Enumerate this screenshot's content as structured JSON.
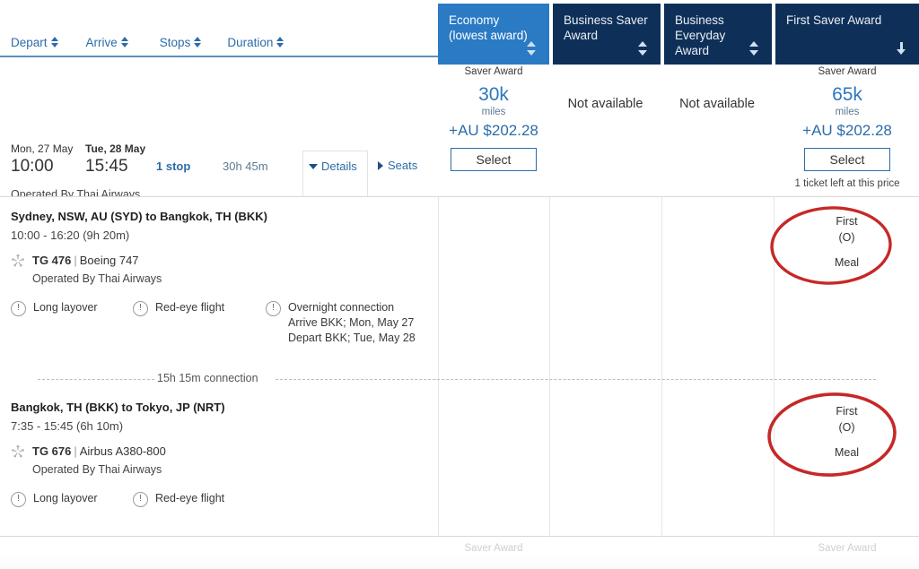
{
  "sort_bar": {
    "items": [
      {
        "label": "Depart",
        "icon": "sort-updown-icon"
      },
      {
        "label": "Arrive",
        "icon": "sort-updown-icon"
      },
      {
        "label": "Stops",
        "icon": "sort-updown-icon"
      },
      {
        "label": "Duration",
        "icon": "sort-updown-icon"
      }
    ]
  },
  "fare_tabs": [
    {
      "label": "Economy\n(lowest award)",
      "line1": "Economy",
      "line2": "(lowest award)",
      "selected": true,
      "sort_icon": "sort-updown-icon"
    },
    {
      "label": "Business Saver Award",
      "line1": "Business Saver",
      "line2": "Award",
      "selected": false,
      "sort_icon": "sort-updown-icon"
    },
    {
      "label": "Business Everyday Award",
      "line1": "Business",
      "line2": "Everyday Award",
      "selected": false,
      "sort_icon": "sort-updown-icon"
    },
    {
      "label": "First Saver Award",
      "line1": "First Saver Award",
      "line2": "",
      "selected": false,
      "sort_icon": "sort-down-icon"
    }
  ],
  "itinerary": {
    "depart_date": "Mon, 27 May",
    "depart_time": "10:00",
    "arrive_date": "Tue, 28 May",
    "arrive_time": "15:45",
    "stops": "1 stop",
    "duration": "30h 45m",
    "operated_by": "Operated By Thai Airways",
    "details_label": "Details",
    "seats_label": "Seats"
  },
  "fares": {
    "economy": {
      "saver_label": "Saver Award",
      "miles": "30k",
      "miles_word": "miles",
      "price": "+AU $202.28",
      "select_label": "Select"
    },
    "business_saver": {
      "status": "Not available"
    },
    "business_everyday": {
      "status": "Not available"
    },
    "first_saver": {
      "saver_label": "Saver Award",
      "miles": "65k",
      "miles_word": "miles",
      "price": "+AU $202.28",
      "select_label": "Select",
      "tickets_left": "1 ticket left at this price"
    }
  },
  "segments": [
    {
      "route": "Sydney, NSW, AU (SYD) to Bangkok, TH (BKK)",
      "times": "10:00 - 16:20 (9h 20m)",
      "flight_number": "TG 476",
      "separator": "|",
      "aircraft": "Boeing 747",
      "operated_by": "Operated By Thai Airways",
      "alliance_icon": "star-alliance-icon",
      "warnings": [
        {
          "icon": "alert-circle-icon",
          "label": "Long layover",
          "sub1": "",
          "sub2": ""
        },
        {
          "icon": "alert-circle-icon",
          "label": "Red-eye flight",
          "sub1": "",
          "sub2": ""
        },
        {
          "icon": "alert-circle-icon",
          "label": "Overnight connection",
          "sub1": "Arrive BKK; Mon, May 27",
          "sub2": "Depart BKK; Tue, May 28"
        }
      ],
      "cabin": {
        "class": "First",
        "code": "(O)",
        "meal": "Meal"
      }
    },
    {
      "route": "Bangkok, TH (BKK) to Tokyo, JP (NRT)",
      "times": "7:35 - 15:45 (6h 10m)",
      "flight_number": "TG 676",
      "separator": "|",
      "aircraft": "Airbus A380-800",
      "operated_by": "Operated By Thai Airways",
      "alliance_icon": "star-alliance-icon",
      "warnings": [
        {
          "icon": "alert-circle-icon",
          "label": "Long layover",
          "sub1": "",
          "sub2": ""
        },
        {
          "icon": "alert-circle-icon",
          "label": "Red-eye flight",
          "sub1": "",
          "sub2": ""
        }
      ],
      "cabin": {
        "class": "First",
        "code": "(O)",
        "meal": "Meal"
      }
    }
  ],
  "connection": {
    "text": "15h 15m connection"
  },
  "next_row": {
    "saver_label_economy": "Saver Award",
    "saver_label_first": "Saver Award"
  },
  "colors": {
    "tab_selected": "#2a7ac4",
    "tab_default": "#0e3058",
    "link_blue": "#2c6ca8",
    "miles_blue": "#2c77bd",
    "annotation_red": "#c62828"
  }
}
